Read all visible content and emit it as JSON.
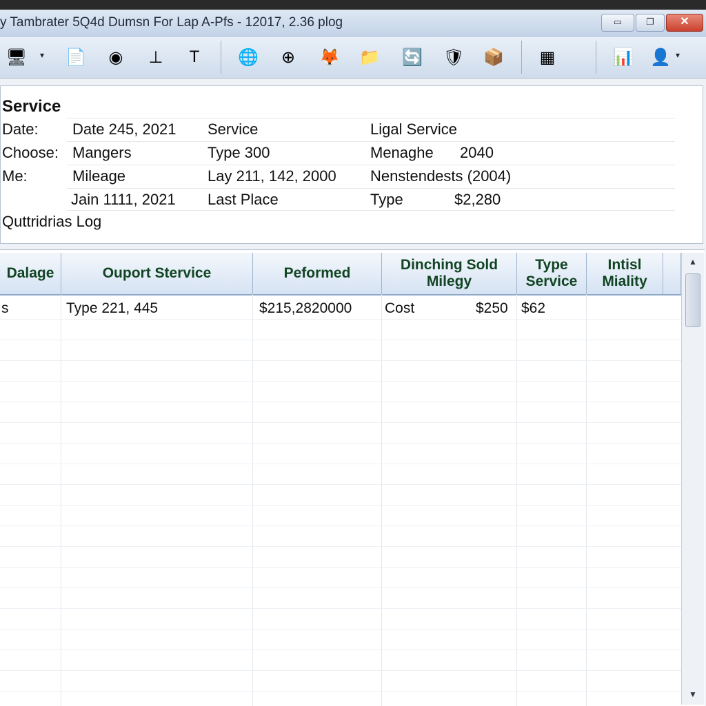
{
  "window": {
    "title": "y Tambrater 5Q4d Dumsn For Lap A-Pfs - 12017, 2.36 plog",
    "buttons": {
      "minimize": "▭",
      "maximize": "❐",
      "close": "✕"
    }
  },
  "toolbar": {
    "icons": [
      "monitor-icon",
      "document-icon",
      "globe-dark-icon",
      "stamp-icon",
      "tool-icon",
      "globe-icon",
      "crosshair-icon",
      "browser-icon",
      "folder-icon",
      "refresh-icon",
      "shield-icon",
      "package-icon",
      "network-icon",
      "chart-icon",
      "user-icon"
    ],
    "glyphs": {
      "monitor": "🖥",
      "document": "📄",
      "globe_dark": "◉",
      "stamp": "⊥",
      "tool": "T",
      "globe": "🌐",
      "crosshair": "⊕",
      "browser": "🦊",
      "folder": "📁",
      "refresh": "🔄",
      "shield": "🛡",
      "package": "📦",
      "network": "▦",
      "chart": "📊",
      "user": "👤",
      "dropdown": "▾"
    }
  },
  "service": {
    "title": "Service",
    "rows": [
      [
        "Date:",
        "Date 245, 2021",
        "Service",
        "Ligal Service",
        ""
      ],
      [
        "Choose:",
        "Mangers",
        "Type 300",
        "Menaghe",
        "2040"
      ],
      [
        "Me:",
        "Mileage",
        "Lay 211, 142, 2000",
        "Nenstendests (2004)",
        ""
      ],
      [
        "",
        "Jain 1111, 2021",
        "Last Place",
        "Type",
        "$2,280"
      ]
    ],
    "log_title": "Quttridrias Log"
  },
  "grid": {
    "headers": [
      "Dalage",
      "Ouport Stervice",
      "Peformed",
      "Dinching Sold Milegy",
      "Type Service",
      "Intisl Miality"
    ],
    "rows": [
      [
        "s",
        "Type 221, 445",
        "$215,2820000",
        "Cost",
        "$250",
        "$62",
        ""
      ]
    ],
    "scroll": {
      "up": "▲",
      "down": "▼",
      "thumb_label": "Ⅱ"
    }
  }
}
